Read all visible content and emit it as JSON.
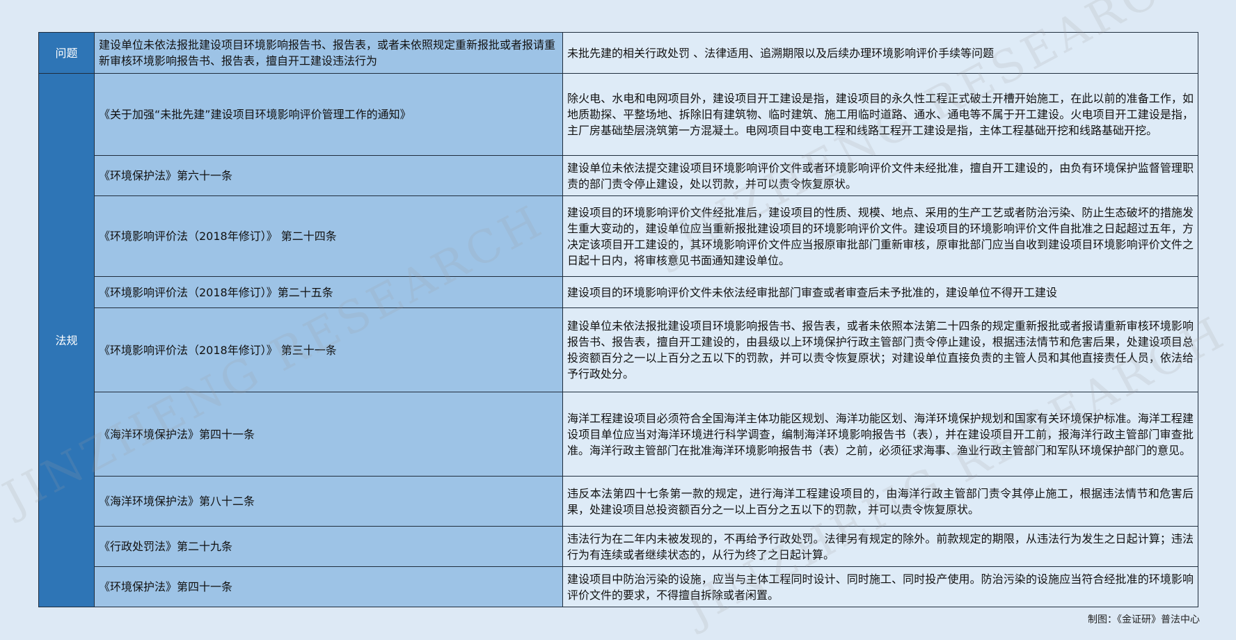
{
  "header": {
    "label": "问题",
    "issue": "建设单位未依法报批建设项目环境影响报告书、报告表，或者未依照规定重新报批或者报请重新审核环境影响报告书、报告表，擅自开工建设违法行为",
    "topic": "未批先建的相关行政处罚 、法律适用、追溯期限以及后续办理环境影响评价手续等问题"
  },
  "section_label": "法规",
  "rows": [
    {
      "law": "《关于加强“未批先建”建设项目环境影响评价管理工作的通知》",
      "content": "除火电、水电和电网项目外，建设项目开工建设是指，建设项目的永久性工程正式破土开槽开始施工，在此以前的准备工作，如地质勘探、平整场地、拆除旧有建筑物、临时建筑、施工用临时道路、通水、通电等不属于开工建设。火电项目开工建设是指，主厂房基础垫层浇筑第一方混凝土。电网项目中变电工程和线路工程开工建设是指，主体工程基础开挖和线路基础开挖。"
    },
    {
      "law": "《环境保护法》第六十一条",
      "content": "建设单位未依法提交建设项目环境影响评价文件或者环境影响评价文件未经批准，擅自开工建设的，由负有环境保护监督管理职责的部门责令停止建设，处以罚款，并可以责令恢复原状。"
    },
    {
      "law": "《环境影响评价法（2018年修订）》 第二十四条",
      "content": "建设项目的环境影响评价文件经批准后，建设项目的性质、规模、地点、采用的生产工艺或者防治污染、防止生态破坏的措施发生重大变动的，建设单位应当重新报批建设项目的环境影响评价文件。建设项目的环境影响评价文件自批准之日起超过五年，方决定该项目开工建设的，其环境影响评价文件应当报原审批部门重新审核，原审批部门应当自收到建设项目环境影响评价文件之日起十日内，将审核意见书面通知建设单位。"
    },
    {
      "law": "《环境影响评价法（2018年修订）》第二十五条",
      "content": "建设项目的环境影响评价文件未依法经审批部门审查或者审查后未予批准的，建设单位不得开工建设"
    },
    {
      "law": "《环境影响评价法（2018年修订）》 第三十一条",
      "content": "建设单位未依法报批建设项目环境影响报告书、报告表，或者未依照本法第二十四条的规定重新报批或者报请重新审核环境影响报告书、报告表，擅自开工建设的，由县级以上环境保护行政主管部门责令停止建设，根据违法情节和危害后果，处建设项目总投资额百分之一以上百分之五以下的罚款，并可以责令恢复原状；对建设单位直接负责的主管人员和其他直接责任人员，依法给予行政处分。"
    },
    {
      "law": "《海洋环境保护法》第四十一条",
      "content": "海洋工程建设项目必须符合全国海洋主体功能区规划、海洋功能区划、海洋环境保护规划和国家有关环境保护标准。海洋工程建设项目单位应当对海洋环境进行科学调查，编制海洋环境影响报告书（表），并在建设项目开工前，报海洋行政主管部门审查批准。海洋行政主管部门在批准海洋环境影响报告书（表）之前，必须征求海事、渔业行政主管部门和军队环境保护部门的意见。"
    },
    {
      "law": "《海洋环境保护法》第八十二条",
      "content": "违反本法第四十七条第一款的规定，进行海洋工程建设项目的，由海洋行政主管部门责令其停止施工，根据违法情节和危害后果，处建设项目总投资额百分之一以上百分之五以下的罚款，并可以责令恢复原状。"
    },
    {
      "law": "《行政处罚法》第二十九条",
      "content": "违法行为在二年内未被发现的，不再给予行政处罚。法律另有规定的除外。前款规定的期限，从违法行为发生之日起计算；违法行为有连续或者继续状态的，从行为终了之日起计算。"
    },
    {
      "law": "《环境保护法》第四十一条",
      "content": "建设项目中防治污染的设施，应当与主体工程同时设计、同时施工、同时投产使用。防治污染的设施应当符合经批准的环境影响评价文件的要求，不得擅自拆除或者闲置。"
    }
  ],
  "watermark": "JINZHENG RESEARCH",
  "footer": "制图：《金证研》普法中心",
  "colors": {
    "background": "#dde9f5",
    "label_column": "#2e75b6",
    "law_column": "#9dc3e6",
    "content_column": "#deebf7",
    "border": "#1f2d3d"
  }
}
